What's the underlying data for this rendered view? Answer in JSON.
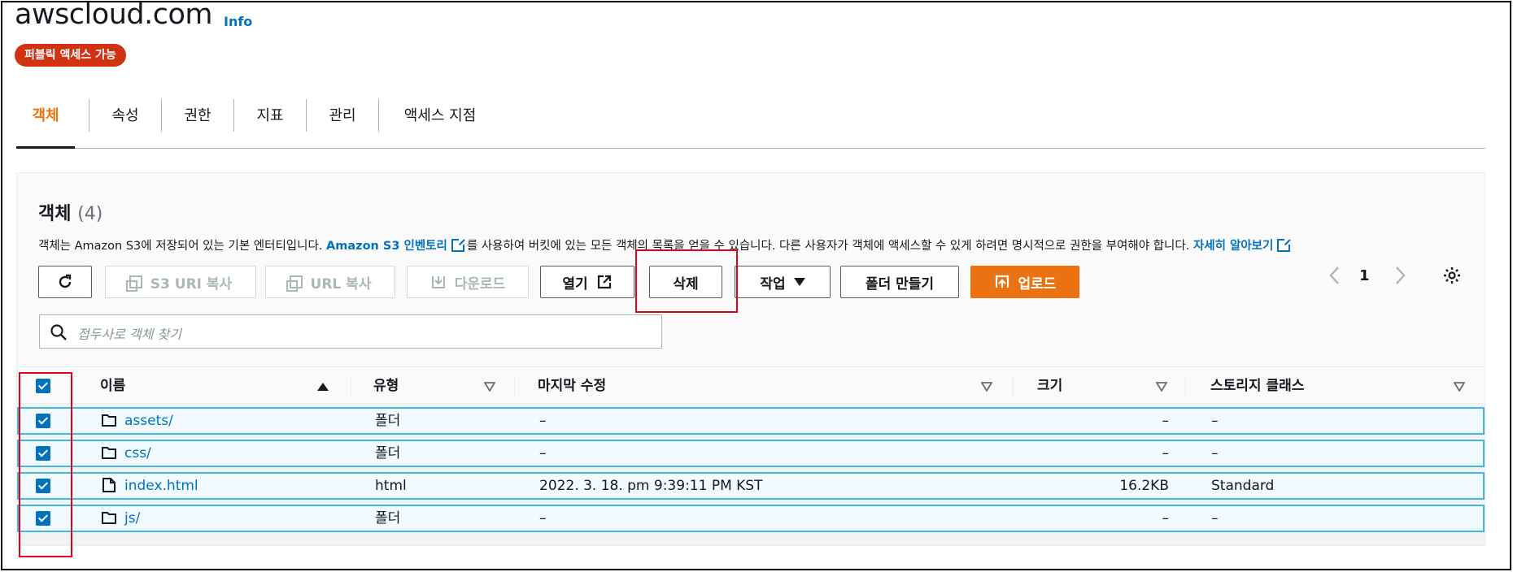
{
  "bucket": {
    "title": "awscloud.com",
    "info": "Info",
    "access_badge": "퍼블릭 액세스 가능"
  },
  "tabs": [
    {
      "label": "객체",
      "active": true
    },
    {
      "label": "속성"
    },
    {
      "label": "권한"
    },
    {
      "label": "지표"
    },
    {
      "label": "관리"
    },
    {
      "label": "액세스 지점"
    }
  ],
  "objects_panel": {
    "title": "객체",
    "count": "(4)",
    "desc_pre": "객체는 Amazon S3에 저장되어 있는 기본 엔터티입니다. ",
    "desc_link1": "Amazon S3 인벤토리",
    "desc_mid": "를 사용하여 버킷에 있는 모든 객체의 목록을 얻을 수 있습니다. 다른 사용자가 객체에 액세스할 수 있게 하려면 명시적으로 권한을 부여해야 합니다. ",
    "desc_link2": "자세히 알아보기"
  },
  "toolbar": {
    "refresh_icon": "refresh-icon",
    "copy_s3_uri": "S3 URI 복사",
    "copy_url": "URL 복사",
    "download": "다운로드",
    "open": "열기",
    "delete": "삭제",
    "actions": "작업",
    "create_folder": "폴더 만들기",
    "upload": "업로드"
  },
  "search": {
    "placeholder": "접두사로 객체 찾기"
  },
  "pagination": {
    "page": "1"
  },
  "table": {
    "columns": [
      "이름",
      "유형",
      "마지막 수정",
      "크기",
      "스토리지 클래스"
    ],
    "rows": [
      {
        "name": "assets/",
        "type": "폴더",
        "modified": "–",
        "size": "–",
        "storage": "–",
        "icon": "folder-icon"
      },
      {
        "name": "css/",
        "type": "폴더",
        "modified": "–",
        "size": "–",
        "storage": "–",
        "icon": "folder-icon"
      },
      {
        "name": "index.html",
        "type": "html",
        "modified": "2022. 3. 18. pm 9:39:11 PM KST",
        "size": "16.2KB",
        "storage": "Standard",
        "icon": "file-icon"
      },
      {
        "name": "js/",
        "type": "폴더",
        "modified": "–",
        "size": "–",
        "storage": "–",
        "icon": "folder-icon"
      }
    ]
  },
  "colors": {
    "accent": "#ec7211",
    "link": "#0073bb",
    "badge": "#d13212",
    "highlight": "#e3001b"
  }
}
